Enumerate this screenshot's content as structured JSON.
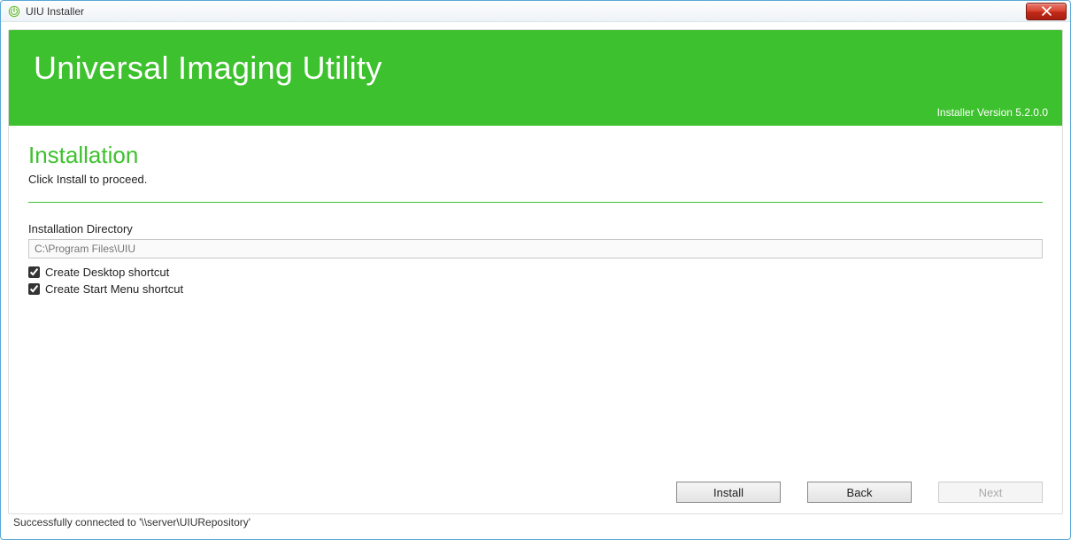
{
  "window": {
    "title": "UIU Installer"
  },
  "banner": {
    "product_name": "Universal Imaging Utility",
    "version_text": "Installer Version 5.2.0.0"
  },
  "stage": {
    "heading": "Installation",
    "subtext": "Click Install to proceed.",
    "dir_label": "Installation Directory",
    "dir_value": "C:\\Program Files\\UIU",
    "checkbox_desktop_label": "Create Desktop shortcut",
    "checkbox_desktop_checked": true,
    "checkbox_startmenu_label": "Create Start Menu shortcut",
    "checkbox_startmenu_checked": true
  },
  "buttons": {
    "install": "Install",
    "back": "Back",
    "next": "Next"
  },
  "statusbar": {
    "text": "Successfully connected to '\\\\server\\UIURepository'"
  }
}
